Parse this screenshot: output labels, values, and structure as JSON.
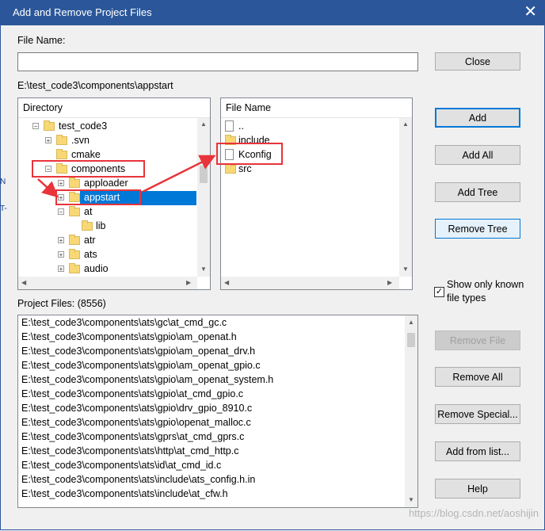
{
  "window": {
    "title": "Add and Remove Project Files",
    "close_glyph": "✕"
  },
  "file_name": {
    "label": "File Name:",
    "value": ""
  },
  "current_path": "E:\\test_code3\\components\\appstart",
  "buttons": {
    "close": "Close",
    "add": "Add",
    "add_all": "Add All",
    "add_tree": "Add Tree",
    "remove_tree": "Remove Tree",
    "remove_file": "Remove File",
    "remove_all": "Remove All",
    "remove_special": "Remove Special...",
    "add_from_list": "Add from list...",
    "help": "Help"
  },
  "directory": {
    "header": "Directory",
    "items": [
      {
        "label": "test_code3",
        "expander": "−"
      },
      {
        "label": ".svn",
        "expander": "+"
      },
      {
        "label": "cmake",
        "expander": ""
      },
      {
        "label": "components",
        "expander": "−"
      },
      {
        "label": "apploader",
        "expander": "+"
      },
      {
        "label": "appstart",
        "expander": "+"
      },
      {
        "label": "at",
        "expander": "−"
      },
      {
        "label": "lib",
        "expander": ""
      },
      {
        "label": "atr",
        "expander": "+"
      },
      {
        "label": "ats",
        "expander": "+"
      },
      {
        "label": "audio",
        "expander": "+"
      }
    ]
  },
  "files": {
    "header": "File Name",
    "items": [
      {
        "label": "..",
        "kind": "doc"
      },
      {
        "label": "include",
        "kind": "folder"
      },
      {
        "label": "Kconfig",
        "kind": "doc"
      },
      {
        "label": "src",
        "kind": "folder"
      }
    ]
  },
  "show_known": {
    "label_line1": "Show only known",
    "label_line2": "file types",
    "checked": "✓"
  },
  "project_files": {
    "label": "Project Files: (8556)",
    "items": [
      "E:\\test_code3\\components\\ats\\gc\\at_cmd_gc.c",
      "E:\\test_code3\\components\\ats\\gpio\\am_openat.h",
      "E:\\test_code3\\components\\ats\\gpio\\am_openat_drv.h",
      "E:\\test_code3\\components\\ats\\gpio\\am_openat_gpio.c",
      "E:\\test_code3\\components\\ats\\gpio\\am_openat_system.h",
      "E:\\test_code3\\components\\ats\\gpio\\at_cmd_gpio.c",
      "E:\\test_code3\\components\\ats\\gpio\\drv_gpio_8910.c",
      "E:\\test_code3\\components\\ats\\gpio\\openat_malloc.c",
      "E:\\test_code3\\components\\ats\\gprs\\at_cmd_gprs.c",
      "E:\\test_code3\\components\\ats\\http\\at_cmd_http.c",
      "E:\\test_code3\\components\\ats\\id\\at_cmd_id.c",
      "E:\\test_code3\\components\\ats\\include\\ats_config.h.in",
      "E:\\test_code3\\components\\ats\\include\\at_cfw.h"
    ]
  },
  "left_edge": {
    "n": "N",
    "t": "T-"
  },
  "watermark": "https://blog.csdn.net/aoshijin",
  "colors": {
    "titlebar": "#2b579a",
    "selection": "#0078d7",
    "annotation": "#e8343a"
  }
}
